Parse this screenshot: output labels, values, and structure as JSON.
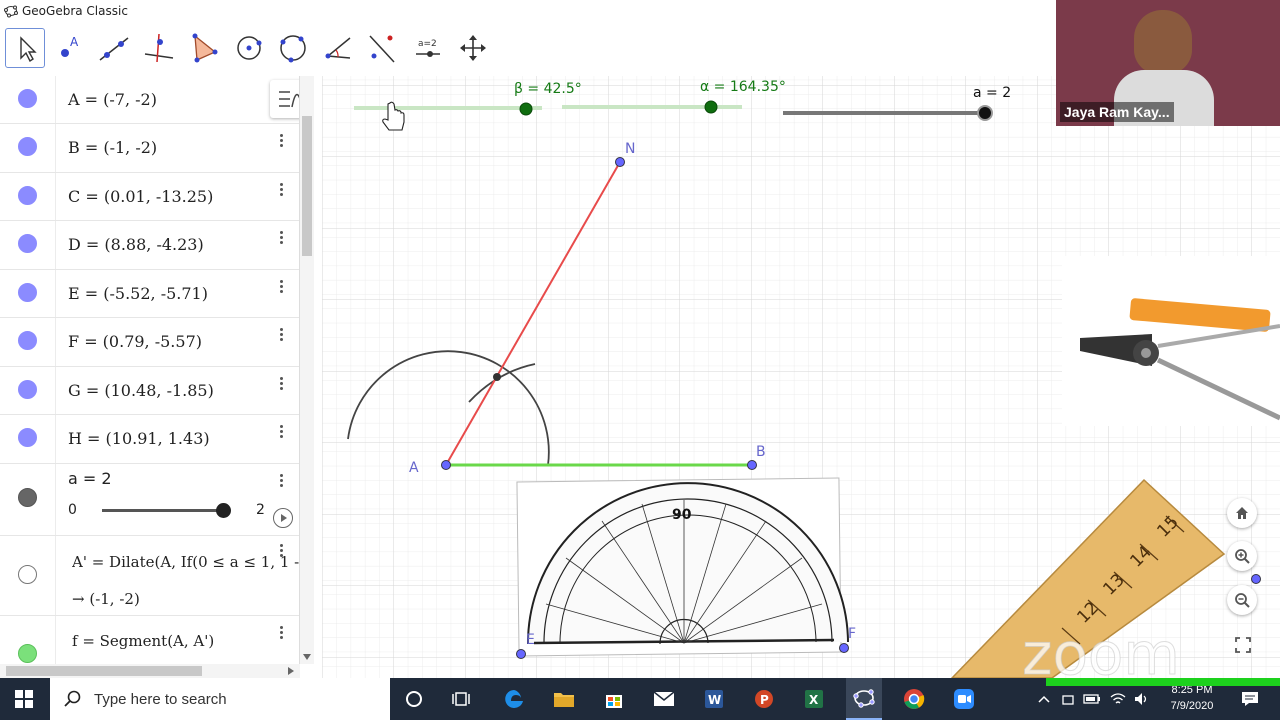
{
  "window": {
    "title": "GeoGebra Classic"
  },
  "algebra": {
    "rows": [
      {
        "expr": "A = (-7, -2)",
        "color": "#8b8bff"
      },
      {
        "expr": "B = (-1, -2)",
        "color": "#8b8bff"
      },
      {
        "expr": "C = (0.01, -13.25)",
        "color": "#8b8bff"
      },
      {
        "expr": "D = (8.88, -4.23)",
        "color": "#8b8bff"
      },
      {
        "expr": "E = (-5.52, -5.71)",
        "color": "#8b8bff"
      },
      {
        "expr": "F = (0.79, -5.57)",
        "color": "#8b8bff"
      },
      {
        "expr": "G = (10.48, -1.85)",
        "color": "#8b8bff"
      },
      {
        "expr": "H = (10.91, 1.43)",
        "color": "#8b8bff"
      }
    ],
    "slider_a": {
      "expr": "a = 2",
      "min": "0",
      "max": "2",
      "value_fraction": 1.0
    },
    "dilate": {
      "expr": "A' = Dilate(A, If(0 ≤ a ≤ 1, 1 -",
      "result": "→  (-1, -2)"
    },
    "segment_f": {
      "expr": "f = Segment(A, A')"
    }
  },
  "graphics": {
    "slider_beta": {
      "label": "β = 42.5°",
      "value_fraction": 0.9
    },
    "slider_alpha": {
      "label": "α = 164.35°",
      "value_fraction": 0.82
    },
    "slider_a": {
      "label": "a = 2",
      "value_fraction": 1.0
    },
    "points": {
      "N": "N",
      "A": "A",
      "B": "B",
      "E": "E",
      "F": "F"
    },
    "protractor_center_label": "90",
    "ruler_labels": [
      "15",
      "14",
      "13",
      "12"
    ],
    "watermark": "zoom",
    "colors": {
      "ray": "#e84b4b",
      "segment": "#6ad84a",
      "point": "#6666ff",
      "arc": "#444444"
    }
  },
  "webcam": {
    "name": "Jaya Ram Kay..."
  },
  "taskbar": {
    "search_placeholder": "Type here to search",
    "time": "8:25 PM",
    "date": "7/9/2020"
  }
}
